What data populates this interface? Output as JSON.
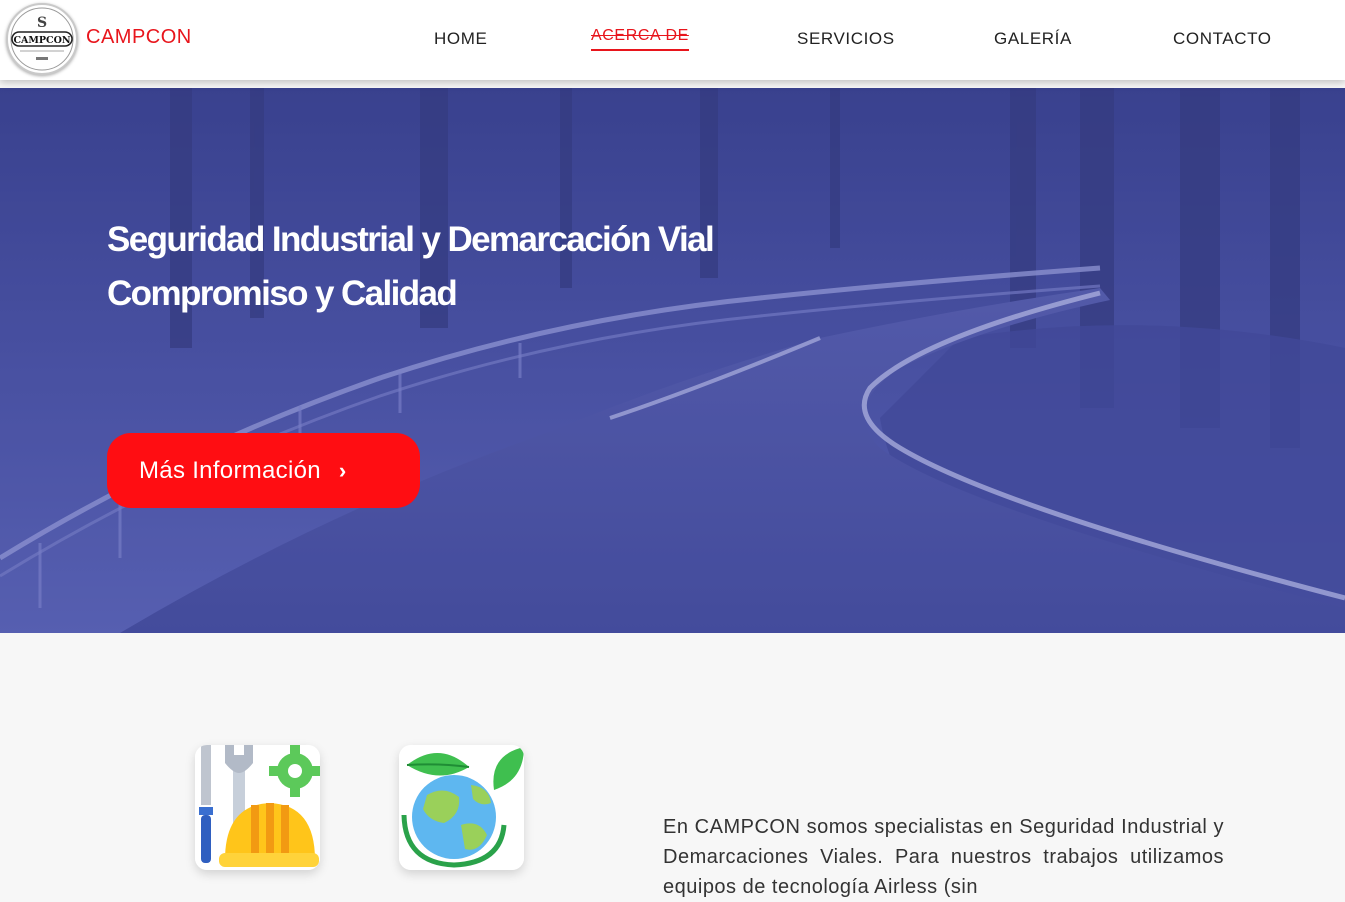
{
  "header": {
    "brand": "CAMPCON",
    "logo_text": "CAMPCON",
    "nav": [
      {
        "label": "HOME"
      },
      {
        "label": "ACERCA DE"
      },
      {
        "label": "SERVICIOS"
      },
      {
        "label": "GALERÍA"
      },
      {
        "label": "CONTACTO"
      }
    ],
    "active_index": 1
  },
  "hero": {
    "title_line1": "Seguridad Industrial y Demarcación Vial",
    "title_line2": "Compromiso y Calidad",
    "button_label": "Más Información",
    "button_icon": "chevron-right-icon",
    "overlay_color": "#4b52a3"
  },
  "features": {
    "icon_1": "industrial-safety-tools-icon",
    "icon_2": "eco-globe-icon"
  },
  "about": {
    "text": "En CAMPCON somos specialistas en Seguridad Industrial y Demarcaciones Viales. Para nuestros trabajos utilizamos equipos de tecnología Airless (sin"
  },
  "colors": {
    "accent": "#e8151c",
    "button": "#ff0d12",
    "background": "#f7f7f7"
  }
}
